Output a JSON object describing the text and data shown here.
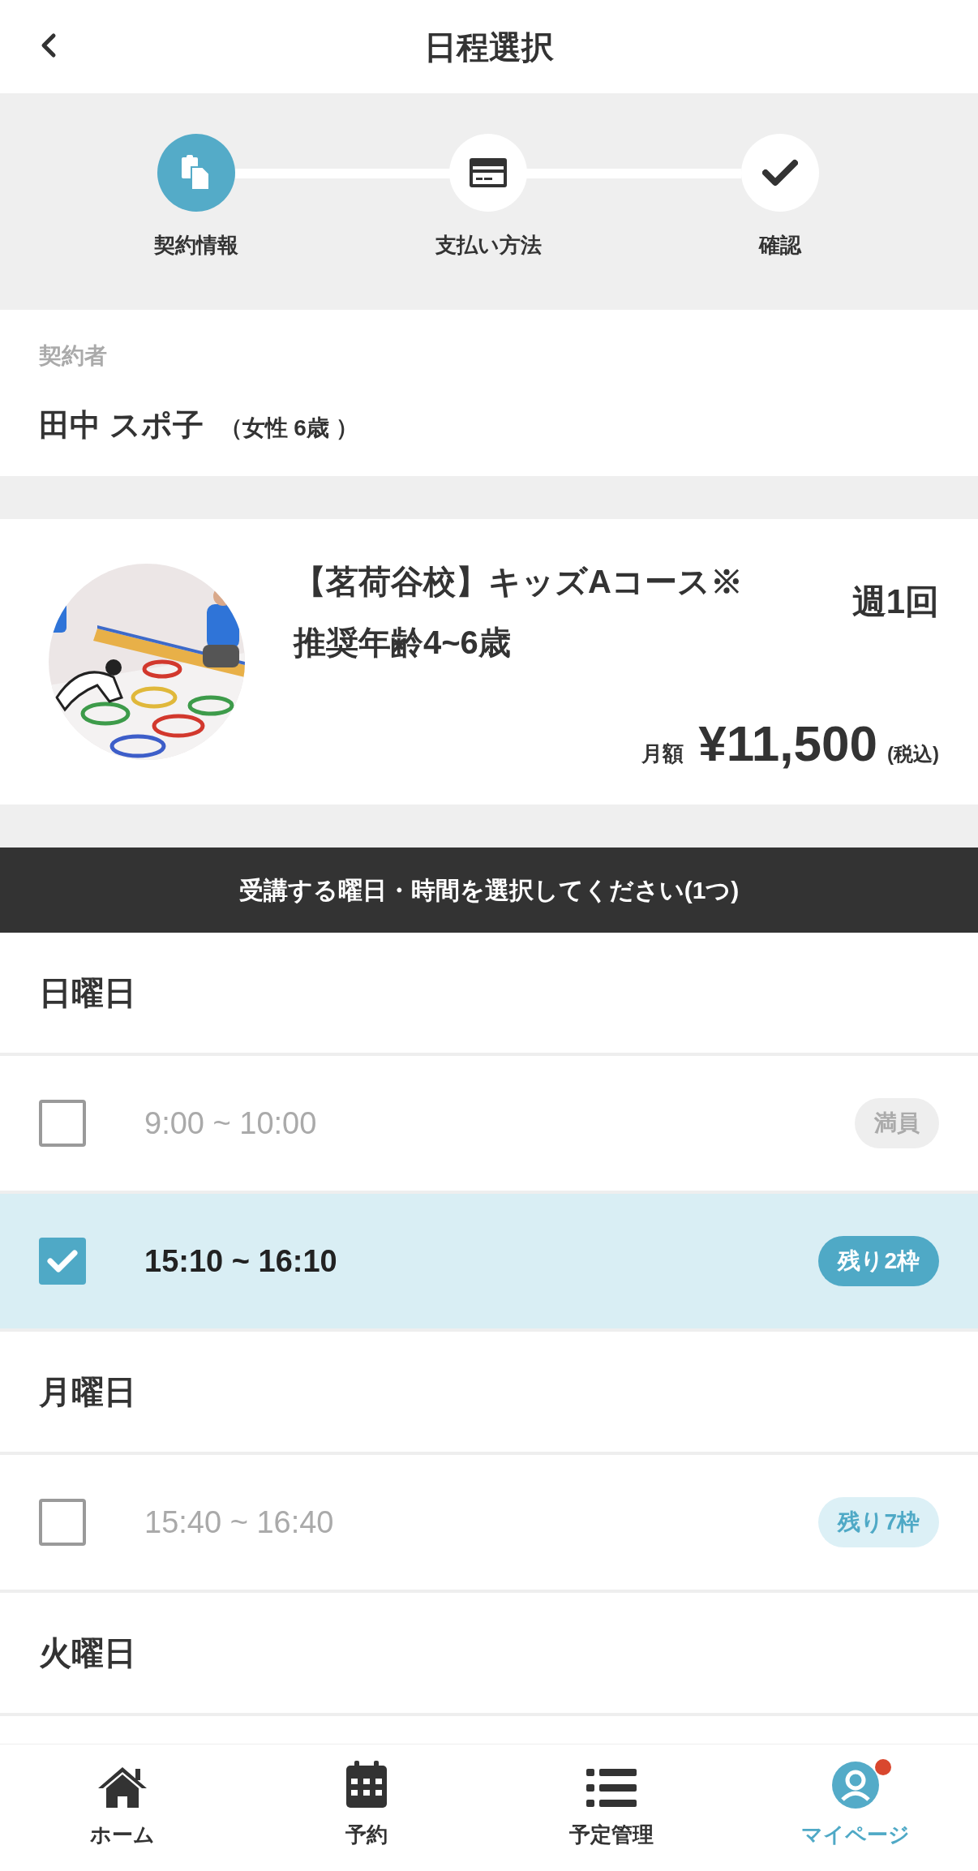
{
  "header": {
    "title": "日程選択"
  },
  "steps": [
    {
      "label": "契約情報",
      "selected": true
    },
    {
      "label": "支払い方法",
      "selected": false
    },
    {
      "label": "確認",
      "selected": false
    }
  ],
  "contractor": {
    "label": "契約者",
    "name": "田中 スポ子",
    "detail": "（女性 6歳 ）"
  },
  "course": {
    "title": "【茗荷谷校】キッズAコース※推奨年齢4~6歳",
    "frequency": "週1回",
    "price_label": "月額",
    "price": "¥11,500",
    "tax": "(税込)"
  },
  "instruction": "受講する曜日・時間を選択してください(1つ)",
  "days": [
    {
      "day": "日曜日",
      "slots": [
        {
          "time": "9:00 ~ 10:00",
          "selected": false,
          "badge": {
            "text": "満員",
            "kind": "full"
          }
        },
        {
          "time": "15:10 ~ 16:10",
          "selected": true,
          "badge": {
            "text": "残り2枠",
            "kind": "open"
          }
        }
      ]
    },
    {
      "day": "月曜日",
      "slots": [
        {
          "time": "15:40 ~ 16:40",
          "selected": false,
          "badge": {
            "text": "残り7枠",
            "kind": "open"
          }
        }
      ]
    },
    {
      "day": "火曜日"
    }
  ],
  "tab_bar": [
    {
      "label": "ホーム",
      "selected": false,
      "dot": false
    },
    {
      "label": "予約",
      "selected": false,
      "dot": false
    },
    {
      "label": "予定管理",
      "selected": false,
      "dot": false
    },
    {
      "label": "マイページ",
      "selected": true,
      "dot": true
    }
  ]
}
